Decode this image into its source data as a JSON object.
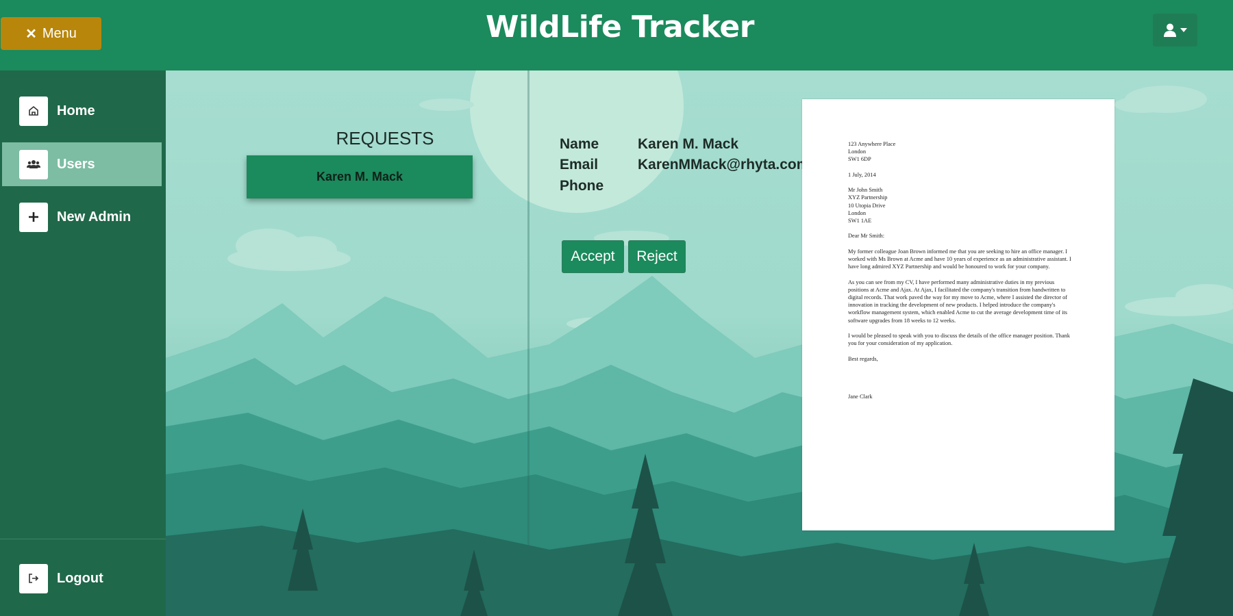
{
  "header": {
    "title": "WildLife Tracker",
    "menu_label": "Menu",
    "menu_icon": "close-icon",
    "user_icon": "user-icon"
  },
  "sidebar": {
    "items": [
      {
        "label": "Home",
        "icon": "home-icon"
      },
      {
        "label": "Users",
        "icon": "users-icon",
        "active": true
      },
      {
        "label": "New Admin",
        "icon": "plus-icon"
      }
    ],
    "logout": {
      "label": "Logout",
      "icon": "logout-icon"
    }
  },
  "requests": {
    "title": "REQUESTS",
    "items": [
      "Karen M. Mack"
    ]
  },
  "details": {
    "name_label": "Name",
    "name_value": "Karen M. Mack",
    "email_label": "Email",
    "email_value": "KarenMMack@rhyta.com",
    "phone_label": "Phone",
    "phone_value": ""
  },
  "actions": {
    "accept": "Accept",
    "reject": "Reject"
  },
  "letter": {
    "sender_address": "123 Anywhere Place\nLondon\nSW1 6DP",
    "date": "1 July, 2014",
    "recipient_address": "Mr John Smith\nXYZ Partnership\n10 Utopia Drive\nLondon\nSW1 1AE",
    "salutation": "Dear Mr Smith:",
    "paragraph1": "My former colleague Joan Brown informed me that you are seeking to hire an office manager. I worked with Ms Brown at Acme and have 10 years of experience as an administrative assistant. I have long admired XYZ Partnership and would be honoured to work for your company.",
    "paragraph2": "As you can see from my CV, I have performed many administrative duties in my previous positions at Acme and Ajax. At Ajax, I facilitated the company's transition from handwritten to digital records. That work paved the way for my move to Acme, where I assisted the director of innovation in tracking the development of new products. I helped introduce the company's workflow management system, which enabled Acme to cut the average development time of its software upgrades from 18 weeks to 12 weeks.",
    "paragraph3": "I would be pleased to speak with you to discuss the details of the office manager position. Thank you for your consideration of my application.",
    "closing": "Best regards,",
    "signature": "Jane Clark"
  },
  "colors": {
    "header": "#1b8a5c",
    "sidebar": "#20684a",
    "active_item": "#7cbda3",
    "menu_button": "#b8860b"
  }
}
